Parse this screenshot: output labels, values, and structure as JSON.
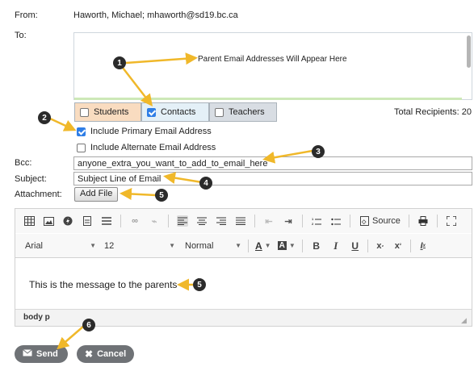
{
  "email": {
    "from_label": "From:",
    "from_value": "Haworth, Michael; mhaworth@sd19.bc.ca",
    "to_label": "To:",
    "to_placeholder_note": "Parent Email Addresses Will Appear Here",
    "recipient_tabs": [
      {
        "label": "Students",
        "checked": false,
        "color": "#f9dcc0"
      },
      {
        "label": "Contacts",
        "checked": true,
        "color": "#e4f0f7"
      },
      {
        "label": "Teachers",
        "checked": false,
        "color": "#d8dde3"
      }
    ],
    "total_recipients": "Total Recipients: 20",
    "options": [
      {
        "label": "Include Primary Email Address",
        "checked": true
      },
      {
        "label": "Include Alternate Email Address",
        "checked": false
      }
    ],
    "bcc_label": "Bcc:",
    "bcc_value": "anyone_extra_you_want_to_add_to_email_here",
    "subject_label": "Subject:",
    "subject_value": "Subject Line of Email",
    "attachment_label": "Attachment:",
    "add_file_label": "Add File"
  },
  "editor": {
    "source_label": "Source",
    "font_family": "Arial",
    "font_size": "12",
    "format": "Normal",
    "body_text": "This is the message to the parents",
    "statusbar": "body  p"
  },
  "actions": {
    "send_label": "Send",
    "cancel_label": "Cancel"
  },
  "annotations": {
    "badges": [
      "1",
      "2",
      "3",
      "4",
      "5",
      "5",
      "6"
    ],
    "arrow_color": "#f0b82a"
  }
}
